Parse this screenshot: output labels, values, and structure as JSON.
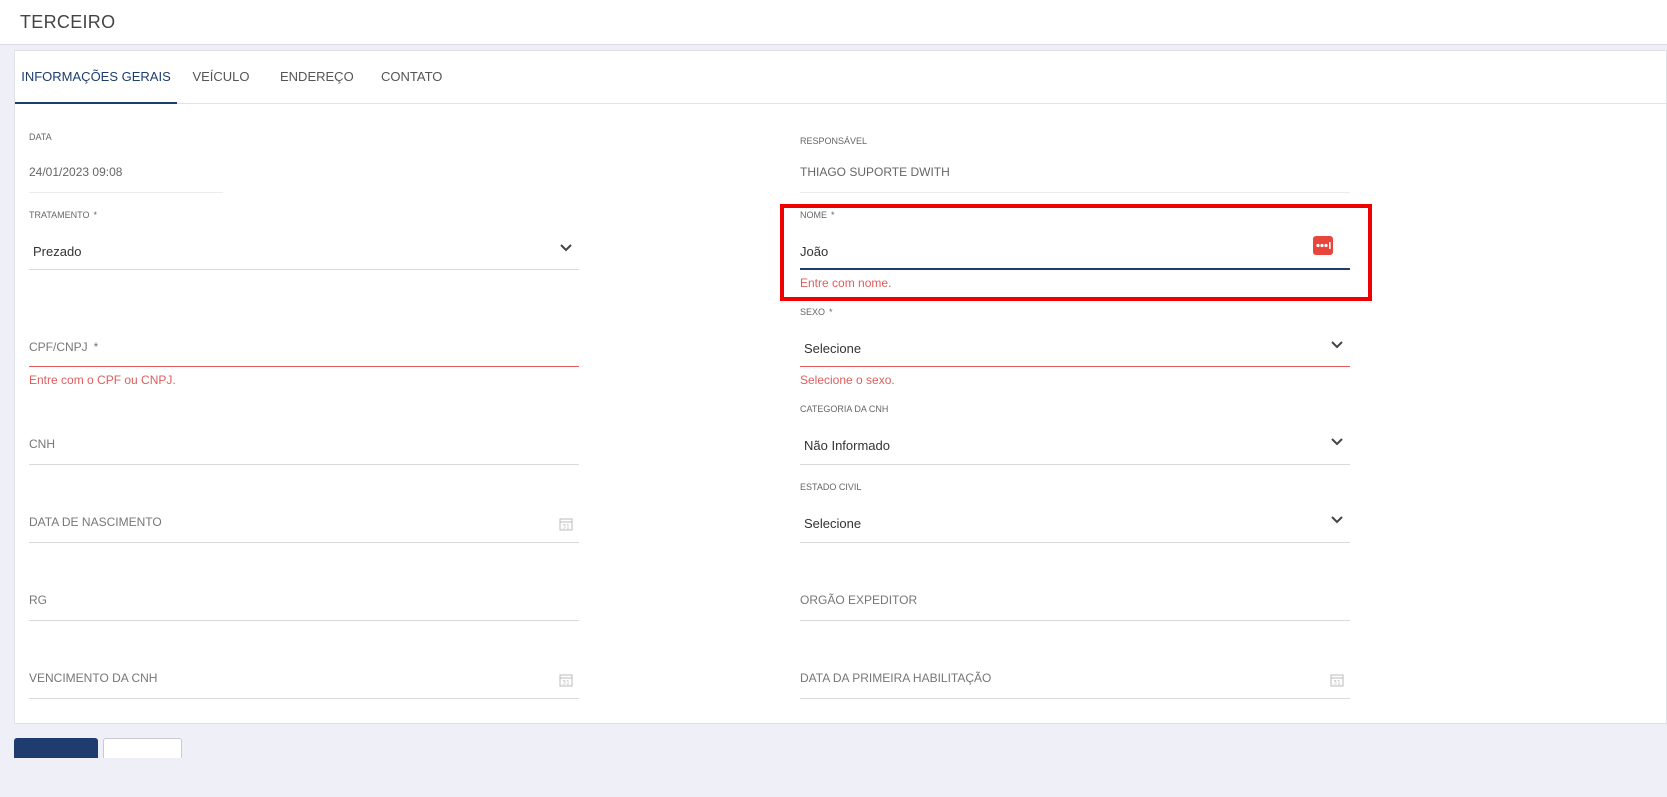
{
  "page": {
    "title": "TERCEIRO"
  },
  "tabs": [
    {
      "label": "INFORMAÇÕES GERAIS",
      "active": true
    },
    {
      "label": "VEÍCULO"
    },
    {
      "label": "ENDEREÇO"
    },
    {
      "label": "CONTATO"
    }
  ],
  "form": {
    "data": {
      "label": "DATA",
      "value": "24/01/2023 09:08"
    },
    "responsavel": {
      "label": "RESPONSÁVEL",
      "value": "THIAGO SUPORTE DWITH"
    },
    "tratamento": {
      "label": "TRATAMENTO",
      "required": "*",
      "value": "Prezado"
    },
    "nome": {
      "label": "NOME",
      "required": "*",
      "value": "João",
      "error": "Entre com nome."
    },
    "cpf": {
      "label": "CPF/CNPJ",
      "required": "*",
      "error": "Entre com o CPF ou CNPJ."
    },
    "sexo": {
      "label": "SEXO",
      "required": "*",
      "value": "Selecione",
      "error": "Selecione o sexo."
    },
    "cnh": {
      "placeholder": "CNH"
    },
    "categoria_cnh": {
      "label": "CATEGORIA DA CNH",
      "value": "Não Informado"
    },
    "nascimento": {
      "placeholder": "DATA DE NASCIMENTO"
    },
    "estado_civil": {
      "label": "ESTADO CIVIL",
      "value": "Selecione"
    },
    "rg": {
      "placeholder": "RG"
    },
    "orgao": {
      "placeholder": "ORGÃO EXPEDITOR"
    },
    "vencimento_cnh": {
      "placeholder": "VENCIMENTO DA CNH"
    },
    "primeira_habilitacao": {
      "placeholder": "DATA DA PRIMEIRA HABILITAÇÃO"
    }
  },
  "colors": {
    "primary": "#1e3d6e",
    "error": "#e05c5c",
    "highlight": "#ee0000"
  },
  "icons": [
    "chevron-down-icon",
    "calendar-icon",
    "password-manager-icon"
  ]
}
